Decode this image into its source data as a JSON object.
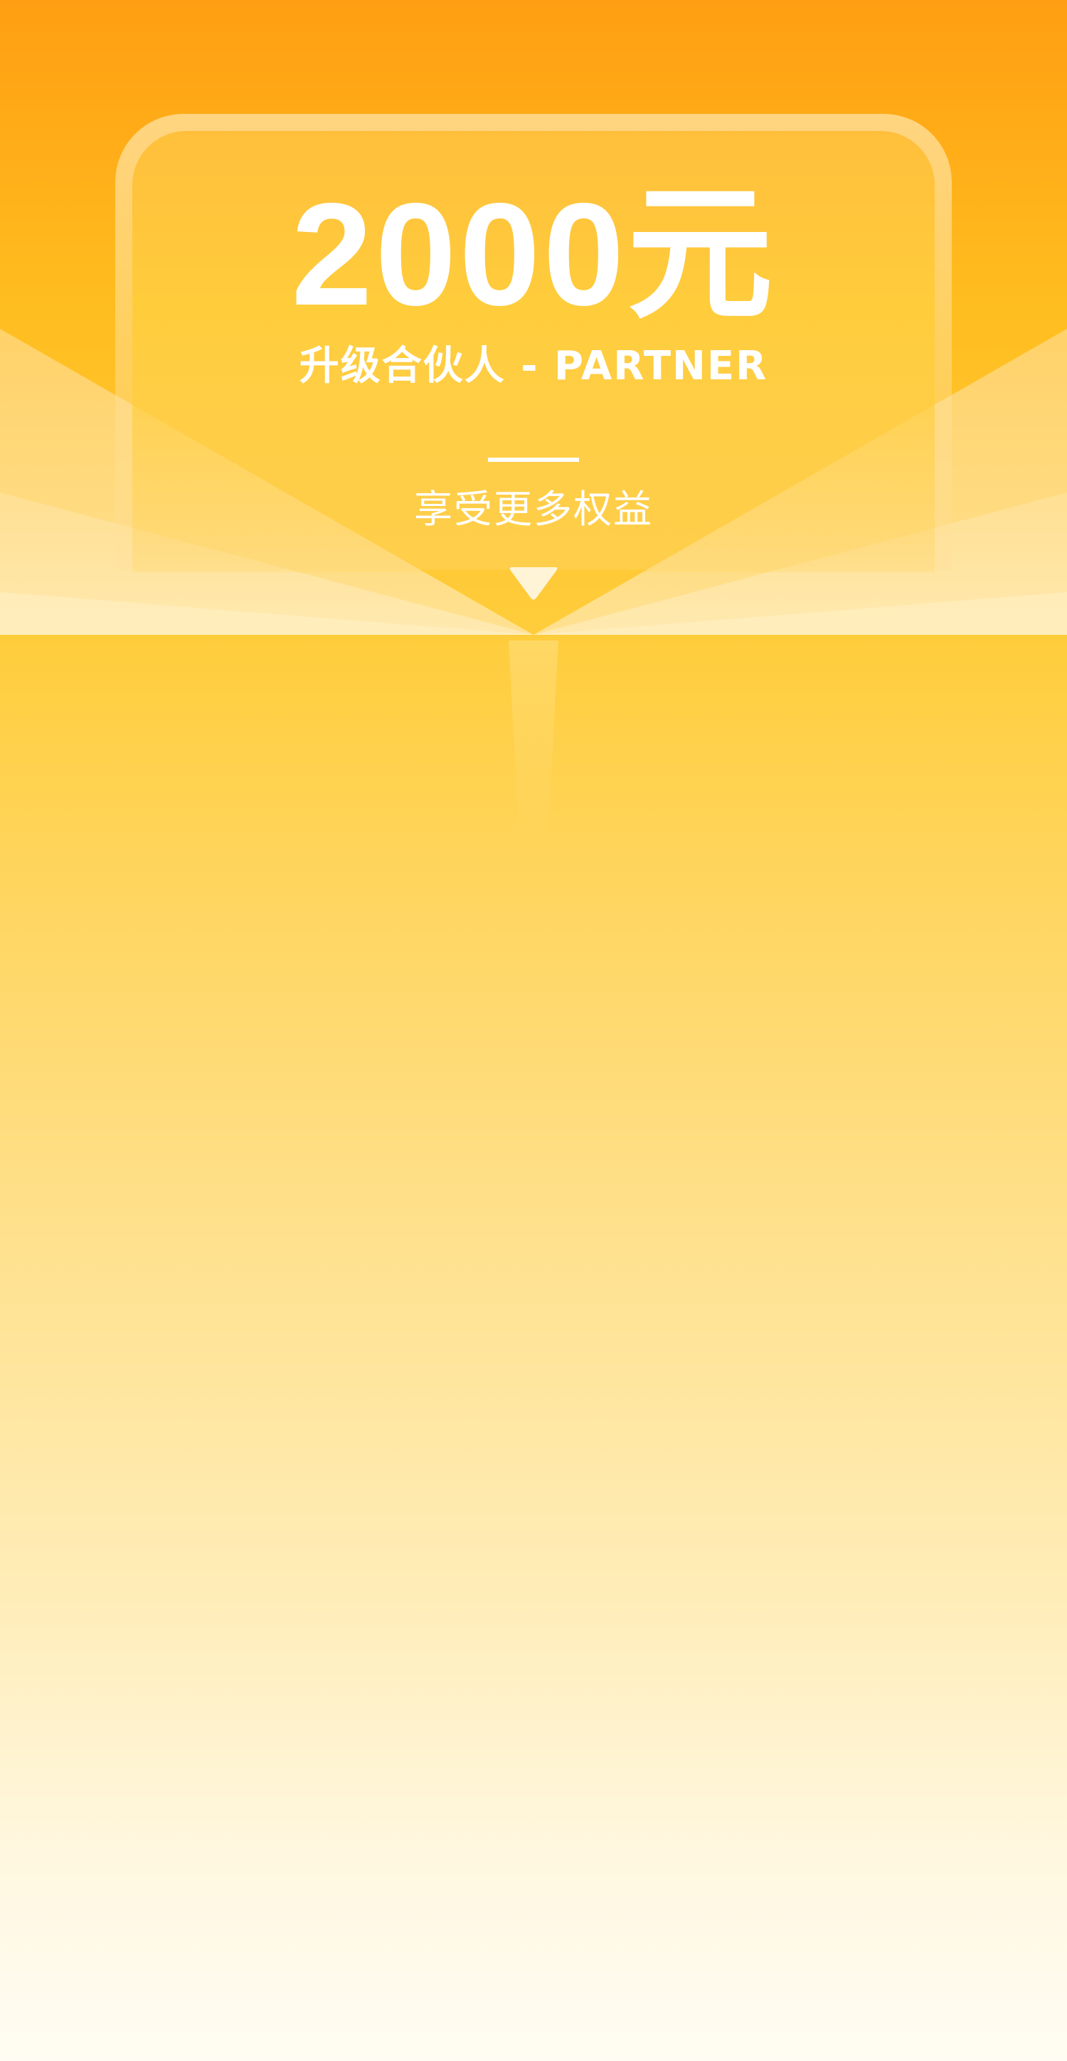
{
  "hero": {
    "amount": "2000元",
    "subtitle": "升级合伙人 - PARTNER",
    "benefits_label": "享受更多权益"
  },
  "icons": {
    "down_arrow": "chevron-down-icon"
  },
  "colors": {
    "top": "#ff9e12",
    "mid": "#ffd45a",
    "bottom": "#fffcf3",
    "text": "#ffffff"
  }
}
